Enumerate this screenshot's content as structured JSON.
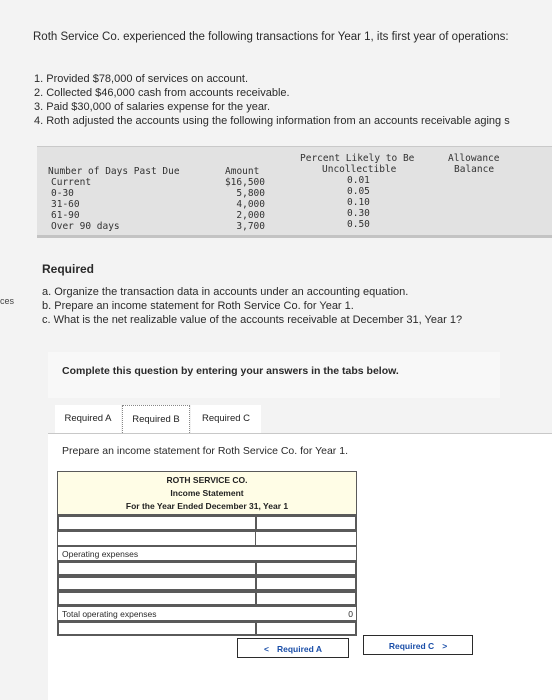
{
  "intro": "Roth Service Co. experienced the following transactions for Year 1, its first year of operations:",
  "steps": [
    "1. Provided $78,000 of services on account.",
    "2. Collected $46,000 cash from accounts receivable.",
    "3. Paid $30,000 of salaries expense for the year.",
    "4. Roth adjusted the accounts using the following information from an accounts receivable aging s"
  ],
  "side_text": "ces",
  "aging": {
    "headers": {
      "days": "Number of Days Past Due",
      "amount": "Amount",
      "percent_line1": "Percent Likely to Be",
      "percent_line2": "Uncollectible",
      "allowance_line1": "Allowance",
      "allowance_line2": "Balance"
    },
    "rows": [
      {
        "days": "Current",
        "amount": "$16,500",
        "percent": "0.01"
      },
      {
        "days": "0-30",
        "amount": "5,800",
        "percent": "0.05"
      },
      {
        "days": "31-60",
        "amount": "4,000",
        "percent": "0.10"
      },
      {
        "days": "61-90",
        "amount": "2,000",
        "percent": "0.30"
      },
      {
        "days": "Over 90 days",
        "amount": "3,700",
        "percent": "0.50"
      }
    ]
  },
  "required": {
    "title": "Required",
    "items": [
      "a. Organize the transaction data in accounts under an accounting equation.",
      "b. Prepare an income statement for Roth Service Co. for Year 1.",
      "c. What is the net realizable value of the accounts receivable at December 31, Year 1?"
    ]
  },
  "complete_text": "Complete this question by entering your answers in the tabs below.",
  "tabs": [
    "Required A",
    "Required B",
    "Required C"
  ],
  "active_tab": "Required B",
  "prepare_text": "Prepare an income statement for Roth Service Co. for Year 1.",
  "statement": {
    "company": "ROTH SERVICE CO.",
    "title": "Income Statement",
    "period": "For the Year Ended December 31, Year 1",
    "operating_expenses_label": "Operating expenses",
    "total_label": "Total operating expenses",
    "total_value": "0"
  },
  "nav": {
    "prev_label": "Required A",
    "next_label": "Required C",
    "prev_arrow": "<",
    "next_arrow": ">"
  }
}
